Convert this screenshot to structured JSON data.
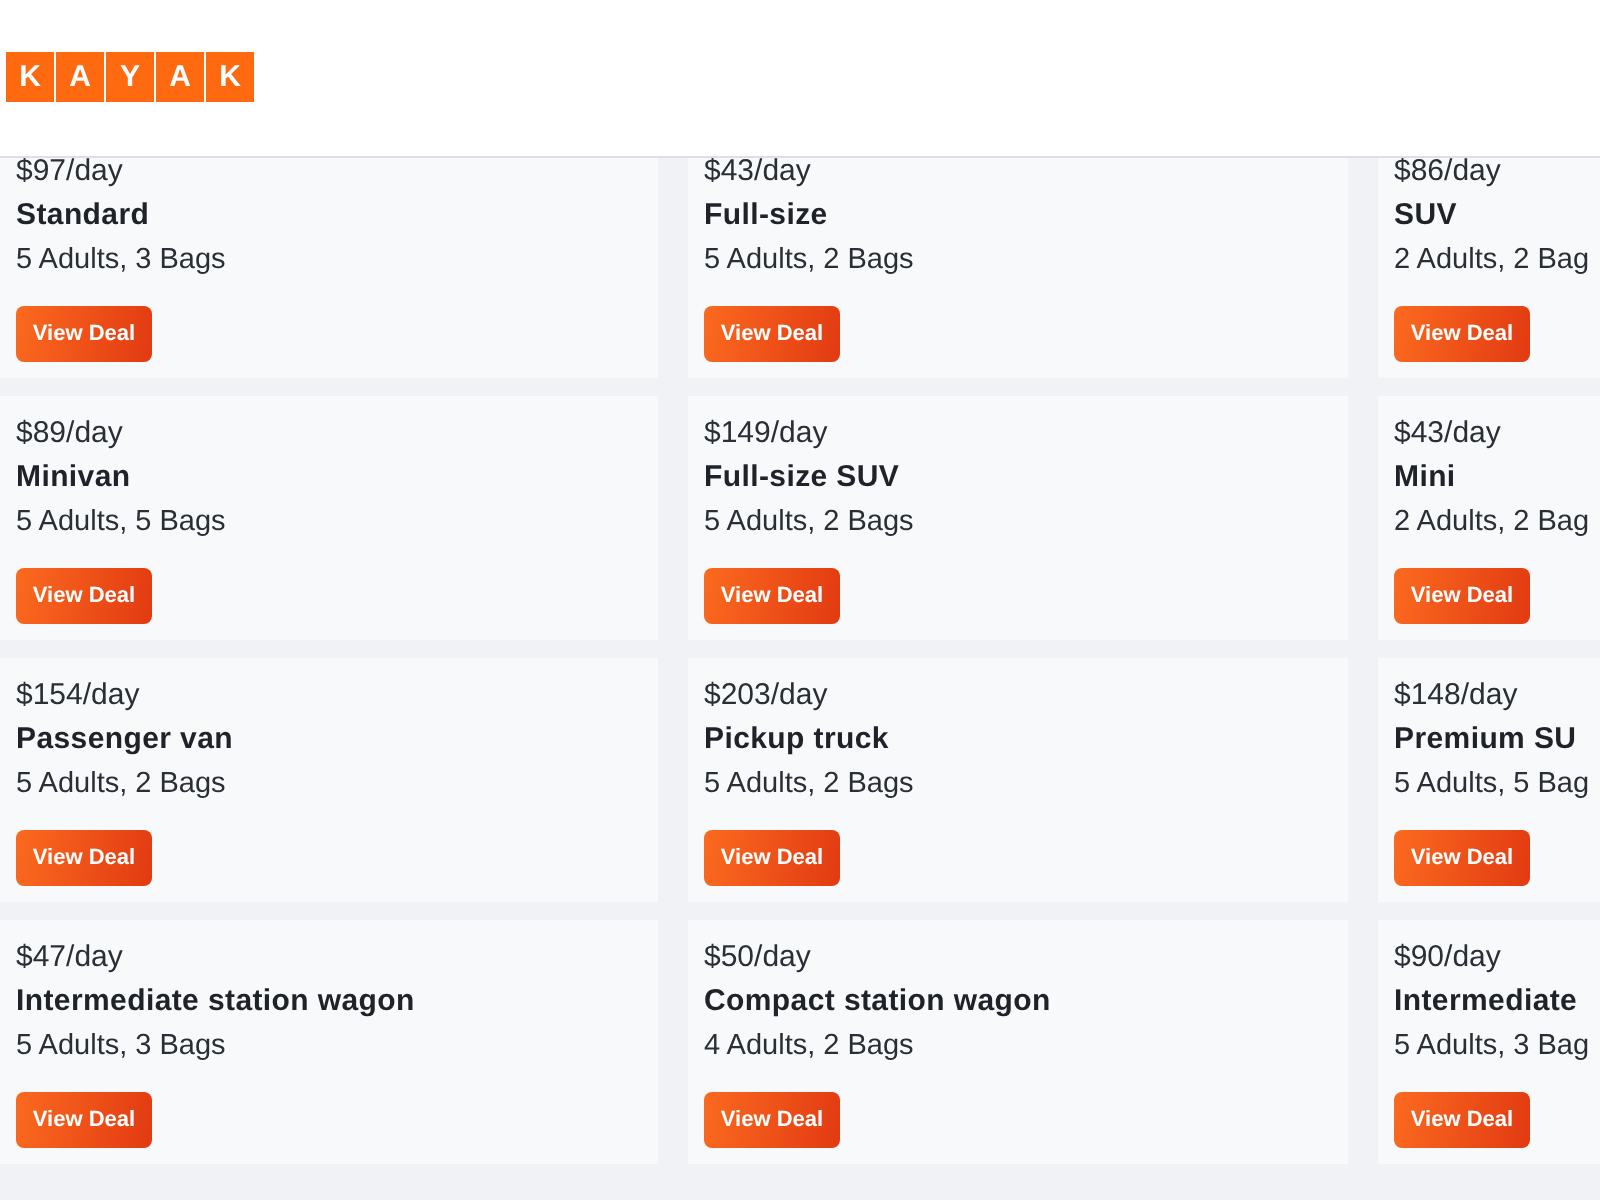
{
  "header": {
    "logo_letters": [
      "K",
      "A",
      "Y",
      "A",
      "K"
    ]
  },
  "deals": [
    {
      "price": "$97/day",
      "name": "Standard",
      "capacity": "5 Adults, 3 Bags",
      "button": "View Deal"
    },
    {
      "price": "$43/day",
      "name": "Full-size",
      "capacity": "5 Adults, 2 Bags",
      "button": "View Deal"
    },
    {
      "price": "$86/day",
      "name": "SUV",
      "capacity": "2 Adults, 2 Bag",
      "button": "View Deal"
    },
    {
      "price": "$89/day",
      "name": "Minivan",
      "capacity": "5 Adults, 5 Bags",
      "button": "View Deal"
    },
    {
      "price": "$149/day",
      "name": "Full-size SUV",
      "capacity": "5 Adults, 2 Bags",
      "button": "View Deal"
    },
    {
      "price": "$43/day",
      "name": "Mini",
      "capacity": "2 Adults, 2 Bag",
      "button": "View Deal"
    },
    {
      "price": "$154/day",
      "name": "Passenger van",
      "capacity": "5 Adults, 2 Bags",
      "button": "View Deal"
    },
    {
      "price": "$203/day",
      "name": "Pickup truck",
      "capacity": "5 Adults, 2 Bags",
      "button": "View Deal"
    },
    {
      "price": "$148/day",
      "name": "Premium SU",
      "capacity": "5 Adults, 5 Bag",
      "button": "View Deal"
    },
    {
      "price": "$47/day",
      "name": "Intermediate station wagon",
      "capacity": "5 Adults, 3 Bags",
      "button": "View Deal"
    },
    {
      "price": "$50/day",
      "name": "Compact station wagon",
      "capacity": "4 Adults, 2 Bags",
      "button": "View Deal"
    },
    {
      "price": "$90/day",
      "name": "Intermediate",
      "capacity": "5 Adults, 3 Bag",
      "button": "View Deal"
    }
  ]
}
